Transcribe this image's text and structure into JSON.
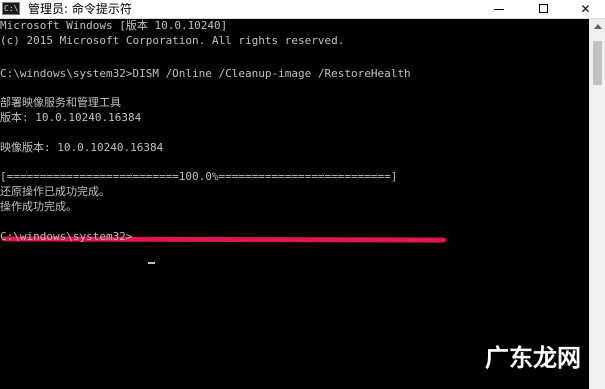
{
  "window": {
    "title": "管理员: 命令提示符",
    "icon_text": "C:\\",
    "controls": {
      "minimize": "minimize",
      "maximize": "maximize",
      "close": "✕"
    }
  },
  "console": {
    "lines": [
      "Microsoft Windows [版本 10.0.10240]",
      "(c) 2015 Microsoft Corporation. All rights reserved.",
      "",
      "C:\\windows\\system32>DISM /Online /Cleanup-image /RestoreHealth",
      "",
      "部署映像服务和管理工具",
      "版本: 10.0.10240.16384",
      "",
      "映像版本: 10.0.10240.16384",
      "",
      "[==========================100.0%==========================]",
      "还原操作已成功完成。",
      "操作成功完成。",
      "",
      "C:\\windows\\system32>"
    ],
    "text_color": "#c0c0c0",
    "background": "#000000"
  },
  "annotation": {
    "underline_color": "#e0164e"
  },
  "watermark": {
    "text": "广东龙网"
  }
}
